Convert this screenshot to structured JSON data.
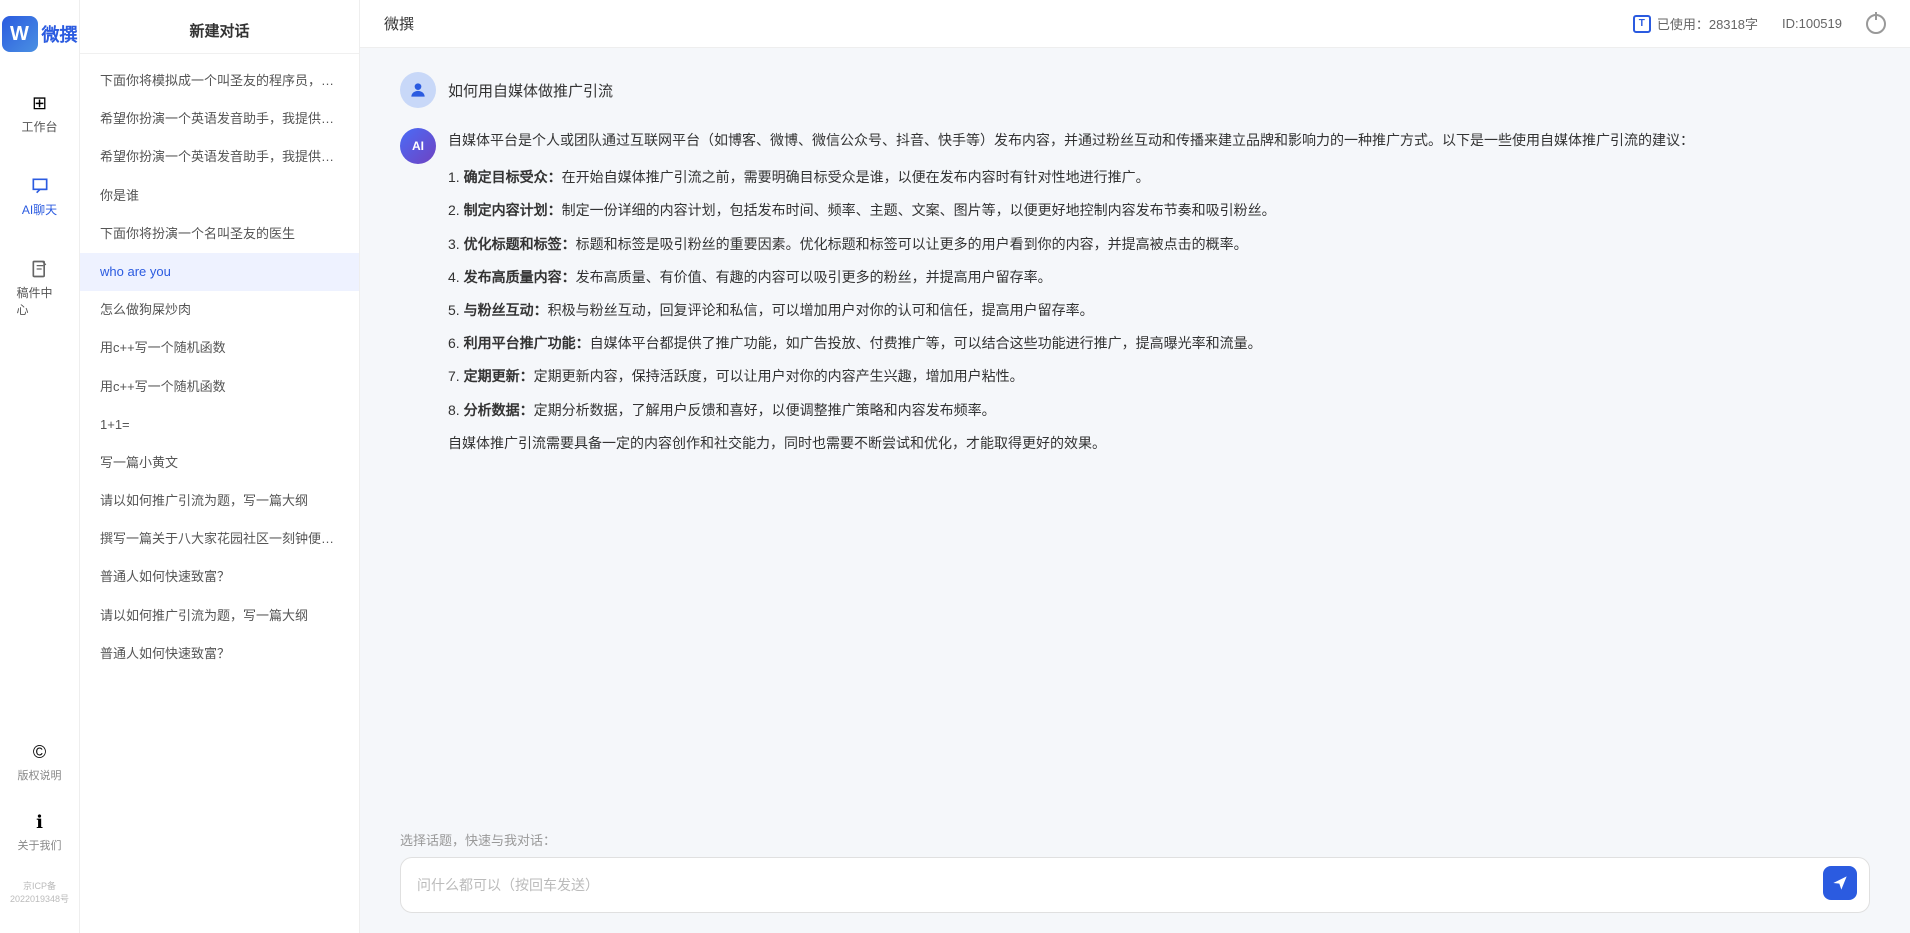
{
  "app": {
    "name": "微撰",
    "logo_letter": "W"
  },
  "topbar": {
    "title": "微撰",
    "usage_label": "已使用：28318字",
    "id_label": "ID:100519",
    "usage_icon": "T"
  },
  "nav": {
    "items": [
      {
        "id": "workspace",
        "label": "工作台",
        "icon": "⊞"
      },
      {
        "id": "ai-chat",
        "label": "AI聊天",
        "icon": "💬",
        "active": true
      },
      {
        "id": "drafts",
        "label": "稿件中心",
        "icon": "📄"
      }
    ],
    "bottom_items": [
      {
        "id": "copyright",
        "label": "版权说明",
        "icon": "©"
      },
      {
        "id": "about",
        "label": "关于我们",
        "icon": "ℹ"
      }
    ],
    "icp": "京ICP备2022019348号"
  },
  "sidebar": {
    "title": "新建对话",
    "items": [
      {
        "id": 1,
        "text": "下面你将模拟成一个叫圣友的程序员，我说...",
        "active": false
      },
      {
        "id": 2,
        "text": "希望你扮演一个英语发音助手，我提供给你...",
        "active": false
      },
      {
        "id": 3,
        "text": "希望你扮演一个英语发音助手，我提供给你...",
        "active": false
      },
      {
        "id": 4,
        "text": "你是谁",
        "active": false
      },
      {
        "id": 5,
        "text": "下面你将扮演一个名叫圣友的医生",
        "active": false
      },
      {
        "id": 6,
        "text": "who are you",
        "active": true
      },
      {
        "id": 7,
        "text": "怎么做狗屎炒肉",
        "active": false
      },
      {
        "id": 8,
        "text": "用c++写一个随机函数",
        "active": false
      },
      {
        "id": 9,
        "text": "用c++写一个随机函数",
        "active": false
      },
      {
        "id": 10,
        "text": "1+1=",
        "active": false
      },
      {
        "id": 11,
        "text": "写一篇小黄文",
        "active": false
      },
      {
        "id": 12,
        "text": "请以如何推广引流为题，写一篇大纲",
        "active": false
      },
      {
        "id": 13,
        "text": "撰写一篇关于八大家花园社区一刻钟便民生...",
        "active": false
      },
      {
        "id": 14,
        "text": "普通人如何快速致富？",
        "active": false
      },
      {
        "id": 15,
        "text": "请以如何推广引流为题，写一篇大纲",
        "active": false
      },
      {
        "id": 16,
        "text": "普通人如何快速致富？",
        "active": false
      }
    ]
  },
  "chat": {
    "user_message": "如何用自媒体做推广引流",
    "ai_response": {
      "intro": "自媒体平台是个人或团队通过互联网平台（如博客、微博、微信公众号、抖音、快手等）发布内容，并通过粉丝互动和传播来建立品牌和影响力的一种推广方式。以下是一些使用自媒体推广引流的建议：",
      "points": [
        {
          "num": "1",
          "title": "确定目标受众：",
          "content": "在开始自媒体推广引流之前，需要明确目标受众是谁，以便在发布内容时有针对性地进行推广。"
        },
        {
          "num": "2",
          "title": "制定内容计划：",
          "content": "制定一份详细的内容计划，包括发布时间、频率、主题、文案、图片等，以便更好地控制内容发布节奏和吸引粉丝。"
        },
        {
          "num": "3",
          "title": "优化标题和标签：",
          "content": "标题和标签是吸引粉丝的重要因素。优化标题和标签可以让更多的用户看到你的内容，并提高被点击的概率。"
        },
        {
          "num": "4",
          "title": "发布高质量内容：",
          "content": "发布高质量、有价值、有趣的内容可以吸引更多的粉丝，并提高用户留存率。"
        },
        {
          "num": "5",
          "title": "与粉丝互动：",
          "content": "积极与粉丝互动，回复评论和私信，可以增加用户对你的认可和信任，提高用户留存率。"
        },
        {
          "num": "6",
          "title": "利用平台推广功能：",
          "content": "自媒体平台都提供了推广功能，如广告投放、付费推广等，可以结合这些功能进行推广，提高曝光率和流量。"
        },
        {
          "num": "7",
          "title": "定期更新：",
          "content": "定期更新内容，保持活跃度，可以让用户对你的内容产生兴趣，增加用户粘性。"
        },
        {
          "num": "8",
          "title": "分析数据：",
          "content": "定期分析数据，了解用户反馈和喜好，以便调整推广策略和内容发布频率。"
        }
      ],
      "conclusion": "自媒体推广引流需要具备一定的内容创作和社交能力，同时也需要不断尝试和优化，才能取得更好的效果。"
    }
  },
  "input": {
    "quick_label": "选择话题，快速与我对话：",
    "placeholder": "问什么都可以（按回车发送）"
  }
}
